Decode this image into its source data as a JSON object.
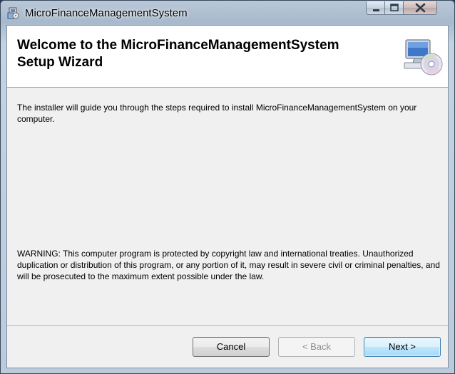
{
  "window": {
    "title": "MicroFinanceManagementSystem"
  },
  "banner": {
    "title_line1": "Welcome to the MicroFinanceManagementSystem",
    "title_line2": "Setup Wizard"
  },
  "content": {
    "intro": "The installer will guide you through the steps required to install MicroFinanceManagementSystem on your computer.",
    "warning": "WARNING: This computer program is protected by copyright law and international treaties. Unauthorized duplication or distribution of this program, or any portion of it, may result in severe civil or criminal penalties, and will be prosecuted to the maximum extent possible under the law."
  },
  "buttons": {
    "cancel": "Cancel",
    "back": "< Back",
    "next": "Next >"
  },
  "icons": {
    "title": "installer-icon",
    "banner": "computer-cd-icon",
    "minimize": "minimize-icon",
    "maximize": "maximize-icon",
    "close": "close-icon"
  }
}
